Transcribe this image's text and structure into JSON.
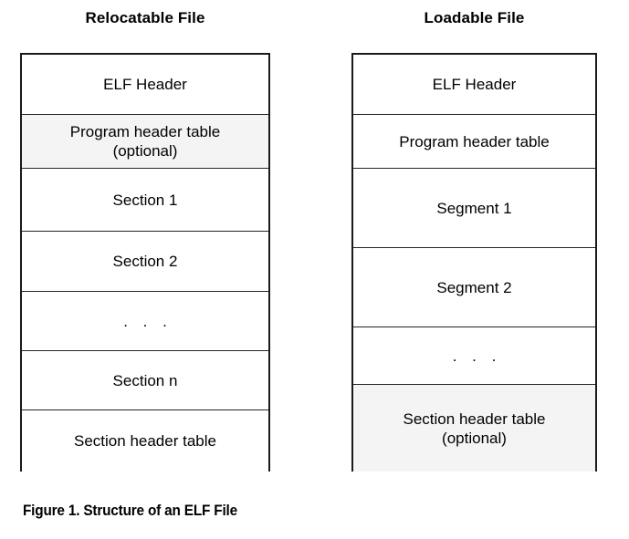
{
  "figure": {
    "caption": "Figure 1.  Structure of an ELF File",
    "background_color": "#ffffff",
    "border_color": "#1a1a1a",
    "shaded_row_color": "#f4f4f4",
    "text_color": "#000000"
  },
  "columns": [
    {
      "key": "relocatable",
      "title": "Relocatable File",
      "rows": [
        {
          "label": "ELF Header",
          "shaded": false,
          "ellipsis": false
        },
        {
          "label": "Program header table\n(optional)",
          "shaded": true,
          "ellipsis": false
        },
        {
          "label": "Section 1",
          "shaded": false,
          "ellipsis": false
        },
        {
          "label": "Section 2",
          "shaded": false,
          "ellipsis": false
        },
        {
          "label": ". . .",
          "shaded": false,
          "ellipsis": true
        },
        {
          "label": "Section n",
          "shaded": false,
          "ellipsis": false
        },
        {
          "label": "Section header table",
          "shaded": false,
          "ellipsis": false
        }
      ]
    },
    {
      "key": "loadable",
      "title": "Loadable File",
      "rows": [
        {
          "label": "ELF Header",
          "shaded": false,
          "ellipsis": false
        },
        {
          "label": "Program header table",
          "shaded": false,
          "ellipsis": false
        },
        {
          "label": "Segment 1",
          "shaded": false,
          "ellipsis": false
        },
        {
          "label": "Segment 2",
          "shaded": false,
          "ellipsis": false
        },
        {
          "label": ". . .",
          "shaded": false,
          "ellipsis": true
        },
        {
          "label": "Section header table\n(optional)",
          "shaded": true,
          "ellipsis": false
        }
      ]
    }
  ],
  "layout": {
    "relocatable_row_heights": [
      66,
      59,
      69,
      66,
      65,
      65,
      67
    ],
    "loadable_row_heights": [
      66,
      59,
      87,
      87,
      63,
      95
    ]
  }
}
